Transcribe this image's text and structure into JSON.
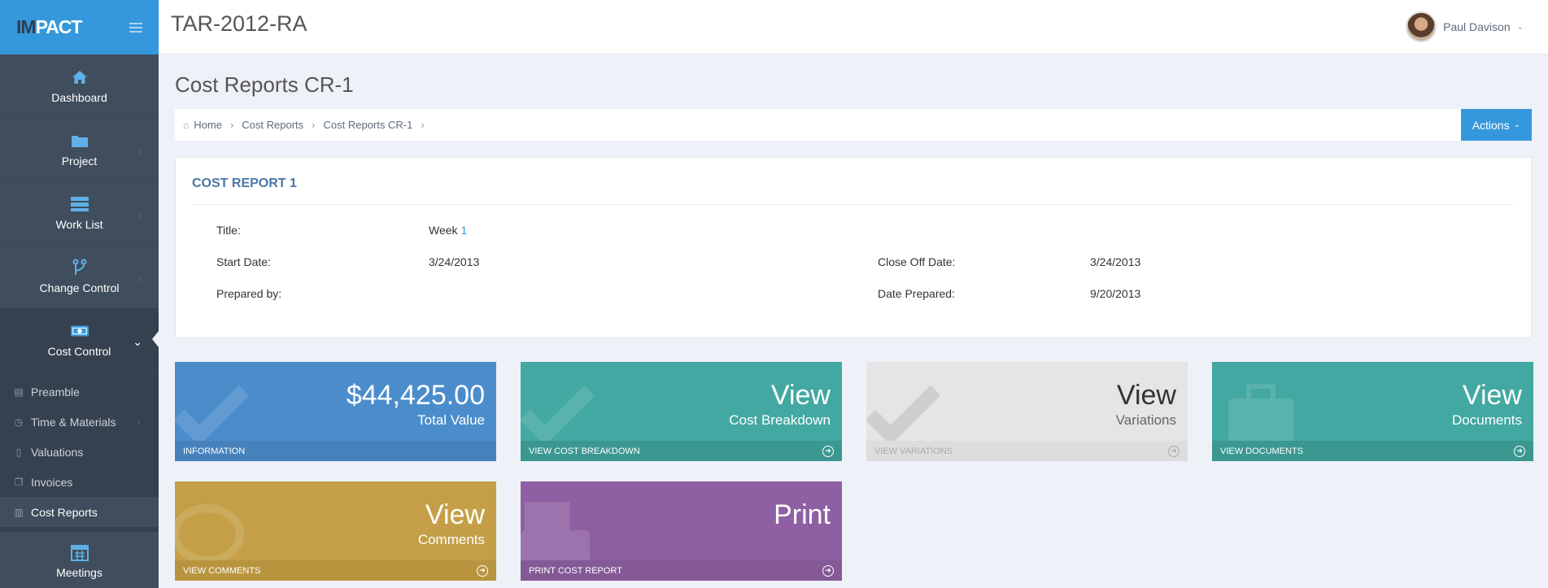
{
  "app": {
    "logo_im": "IM",
    "logo_pact": "PACT",
    "project_code": "TAR-2012-RA"
  },
  "user": {
    "name": "Paul Davison"
  },
  "sidebar": {
    "items": [
      {
        "label": "Dashboard",
        "icon": "home-icon"
      },
      {
        "label": "Project",
        "icon": "folder-icon"
      },
      {
        "label": "Work List",
        "icon": "list-icon"
      },
      {
        "label": "Change Control",
        "icon": "branch-icon"
      },
      {
        "label": "Cost Control",
        "icon": "money-icon"
      }
    ],
    "sub_items": [
      {
        "label": "Preamble",
        "icon": "book-icon"
      },
      {
        "label": "Time & Materials",
        "icon": "clock-icon"
      },
      {
        "label": "Valuations",
        "icon": "file-icon"
      },
      {
        "label": "Invoices",
        "icon": "copy-icon"
      },
      {
        "label": "Cost Reports",
        "icon": "bar-chart-icon"
      }
    ],
    "bottom_item": {
      "label": "Meetings",
      "icon": "calendar-icon"
    }
  },
  "page": {
    "title": "Cost Reports CR-1",
    "breadcrumb": [
      "Home",
      "Cost Reports",
      "Cost Reports CR-1"
    ],
    "actions_label": "Actions"
  },
  "report": {
    "heading": "COST REPORT 1",
    "title_label": "Title:",
    "title_value_prefix": "Week",
    "title_value_num": "1",
    "start_label": "Start Date:",
    "start_value": "3/24/2013",
    "close_label": "Close Off Date:",
    "close_value": "3/24/2013",
    "prepared_by_label": "Prepared by:",
    "prepared_by_value": "",
    "date_prepared_label": "Date Prepared:",
    "date_prepared_value": "9/20/2013"
  },
  "tiles": [
    {
      "big": "$44,425.00",
      "sub": "Total Value",
      "foot": "INFORMATION"
    },
    {
      "big": "View",
      "sub": "Cost Breakdown",
      "foot": "VIEW COST BREAKDOWN"
    },
    {
      "big": "View",
      "sub": "Variations",
      "foot": "VIEW VARIATIONS"
    },
    {
      "big": "View",
      "sub": "Documents",
      "foot": "VIEW DOCUMENTS"
    },
    {
      "big": "View",
      "sub": "Comments",
      "foot": "VIEW COMMENTS"
    },
    {
      "big": "Print",
      "sub": "",
      "foot": "PRINT COST REPORT"
    }
  ],
  "colors": {
    "accent": "#3598dc",
    "sidebar": "#364150",
    "tile_blue": "#4b8dcb",
    "tile_green": "#42a8a1",
    "tile_grey": "#e5e5e5",
    "tile_yellow": "#c49f47",
    "tile_purple": "#8e5fa2"
  }
}
